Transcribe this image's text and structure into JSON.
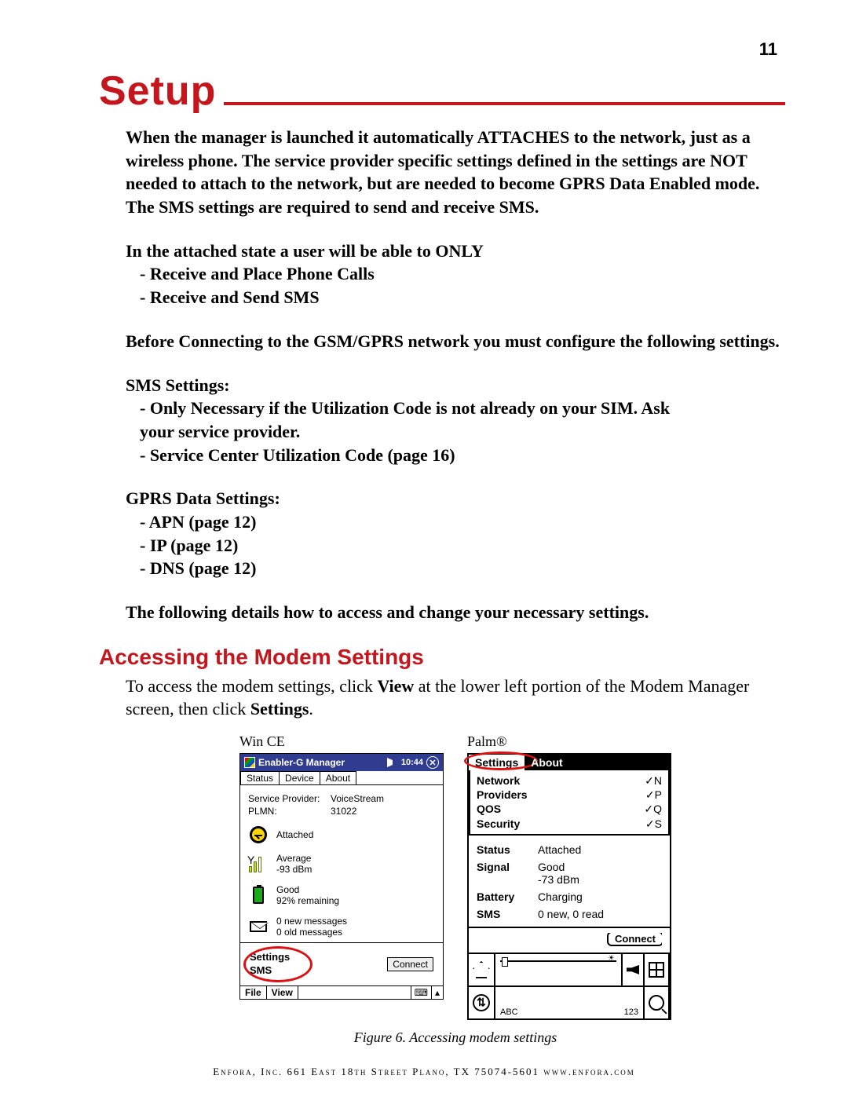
{
  "page_number": "11",
  "title": "Setup",
  "intro_para": "When the manager is launched it automatically ATTACHES to the network, just as a wireless  phone.  The service provider specific settings defined in the settings are NOT needed to attach to the network, but are needed to become GPRS Data Enabled mode.  The SMS settings are required to send and receive SMS.",
  "attached_heading": "In the attached state a user will be able to ONLY",
  "attached_items": [
    "- Receive and Place Phone Calls",
    "- Receive and Send SMS"
  ],
  "before_para": "Before Connecting to the GSM/GPRS network you must configure the following settings.",
  "sms_heading": "SMS Settings:",
  "sms_items": [
    "- Only Necessary if the Utilization Code is not already on your SIM. Ask",
    "  your service provider.",
    "- Service Center Utilization Code (page 16)"
  ],
  "gprs_heading": "GPRS Data Settings:",
  "gprs_items": [
    "- APN (page 12)",
    "- IP (page 12)",
    "- DNS (page 12)"
  ],
  "following_para": "The following details how to access and change your necessary settings.",
  "subheading": "Accessing the Modem Settings",
  "access_pre": "To access the modem settings, click ",
  "access_view": "View",
  "access_mid": " at the lower left portion of the Modem Manager screen, then click ",
  "access_settings": "Settings",
  "access_post": ".",
  "fig_caption": "Figure 6.  Accessing modem settings",
  "wince_label": "Win CE",
  "palm_label": "Palm®",
  "wince": {
    "title": "Enabler-G Manager",
    "time": "10:44",
    "tabs": [
      "Status",
      "Device",
      "About"
    ],
    "sp_label": "Service Provider:",
    "sp_value": "VoiceStream",
    "plmn_label": "PLMN:",
    "plmn_value": "31022",
    "attached": "Attached",
    "sig1": "Average",
    "sig2": "-93 dBm",
    "batt1": "Good",
    "batt2": "92% remaining",
    "msg1": "0 new messages",
    "msg2": "0 old messages",
    "link_settings": "Settings",
    "link_sms": "SMS",
    "connect": "Connect",
    "file": "File",
    "view": "View"
  },
  "palm": {
    "menu": [
      "Settings",
      "About"
    ],
    "sub": [
      {
        "l": "Network",
        "r": "✓N"
      },
      {
        "l": "Providers",
        "r": "✓P"
      },
      {
        "l": "QOS",
        "r": "✓Q"
      },
      {
        "l": "Security",
        "r": "✓S"
      }
    ],
    "rows": [
      {
        "l": "Status",
        "v": "Attached"
      },
      {
        "l": "Signal",
        "v": "Good\n-73 dBm"
      },
      {
        "l": "Battery",
        "v": "Charging"
      },
      {
        "l": "SMS",
        "v": "0 new, 0 read"
      }
    ],
    "connect": "Connect",
    "abc": "ABC",
    "num": "123"
  },
  "footer": "Enfora, Inc.  661 East 18th Street  Plano, TX  75074-5601  www.enfora.com"
}
